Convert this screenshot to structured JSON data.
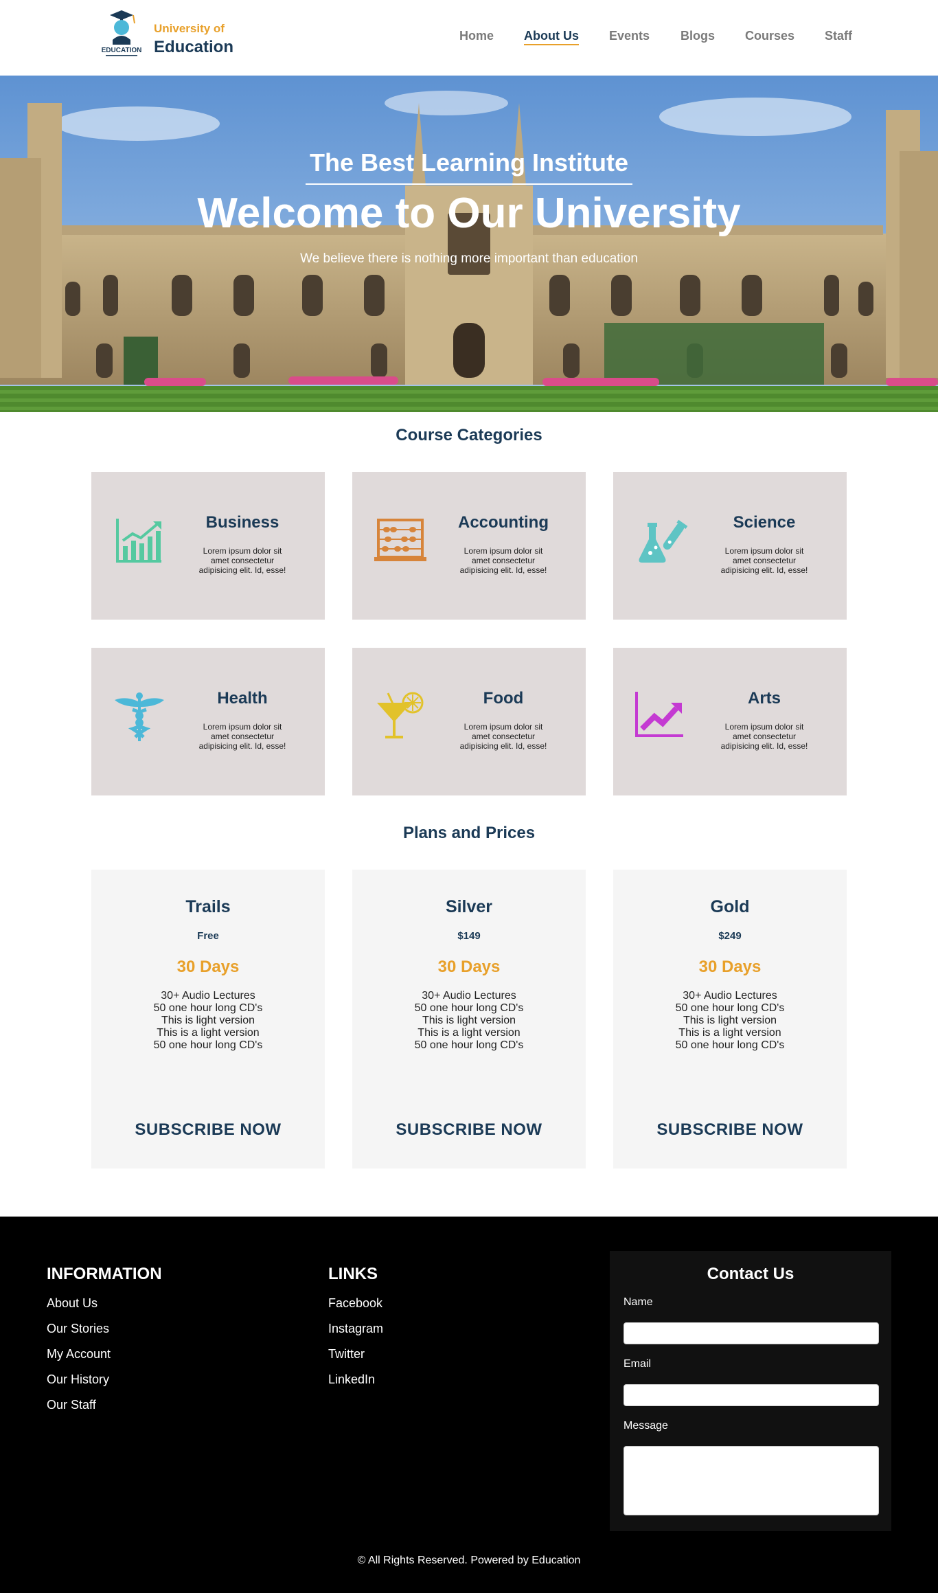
{
  "header": {
    "logo_text": "EDUCATION",
    "brand_top": "University of",
    "brand_main": "Education",
    "nav": [
      "Home",
      "About Us",
      "Events",
      "Blogs",
      "Courses",
      "Staff"
    ],
    "active_nav": "About Us"
  },
  "hero": {
    "subtitle": "The Best Learning Institute",
    "title": "Welcome to Our University",
    "tagline": "We believe there is nothing more important than education"
  },
  "categories": {
    "title": "Course Categories",
    "items": [
      {
        "name": "Business",
        "desc": "Lorem ipsum dolor sit amet consectetur adipisicing elit. Id, esse!",
        "icon": "chart-growth-icon",
        "color": "#55c9a0"
      },
      {
        "name": "Accounting",
        "desc": "Lorem ipsum dolor sit amet consectetur adipisicing elit. Id, esse!",
        "icon": "abacus-icon",
        "color": "#d7843a"
      },
      {
        "name": "Science",
        "desc": "Lorem ipsum dolor sit amet consectetur adipisicing elit. Id, esse!",
        "icon": "flask-icon",
        "color": "#5ec4c4"
      },
      {
        "name": "Health",
        "desc": "Lorem ipsum dolor sit amet consectetur adipisicing elit. Id, esse!",
        "icon": "caduceus-icon",
        "color": "#4cb8d8"
      },
      {
        "name": "Food",
        "desc": "Lorem ipsum dolor sit amet consectetur adipisicing elit. Id, esse!",
        "icon": "cocktail-icon",
        "color": "#e2c22a"
      },
      {
        "name": "Arts",
        "desc": "Lorem ipsum dolor sit amet consectetur adipisicing elit. Id, esse!",
        "icon": "trend-chart-icon",
        "color": "#c43ad2"
      }
    ]
  },
  "plans": {
    "title": "Plans and Prices",
    "items": [
      {
        "name": "Trails",
        "price": "Free",
        "days": "30 Days",
        "features": [
          "30+ Audio Lectures",
          "50 one hour long CD's",
          "This is light version",
          "This is a light version",
          "50 one hour long CD's"
        ],
        "button": "SUBSCRIBE NOW"
      },
      {
        "name": "Silver",
        "price": "$149",
        "days": "30 Days",
        "features": [
          "30+ Audio Lectures",
          "50 one hour long CD's",
          "This is light version",
          "This is a light version",
          "50 one hour long CD's"
        ],
        "button": "SUBSCRIBE NOW"
      },
      {
        "name": "Gold",
        "price": "$249",
        "days": "30 Days",
        "features": [
          "30+ Audio Lectures",
          "50 one hour long CD's",
          "This is light version",
          "This is a light version",
          "50 one hour long CD's"
        ],
        "button": "SUBSCRIBE NOW"
      }
    ]
  },
  "footer": {
    "info_title": "INFORMATION",
    "info_links": [
      "About Us",
      "Our Stories",
      "My Account",
      "Our History",
      "Our Staff"
    ],
    "links_title": "LINKS",
    "links": [
      "Facebook",
      "Instagram",
      "Twitter",
      "LinkedIn"
    ],
    "contact": {
      "title": "Contact Us",
      "name_label": "Name",
      "email_label": "Email",
      "message_label": "Message"
    },
    "copyright": "© All Rights Reserved. Powered by Education"
  },
  "colors": {
    "navy": "#1b3a56",
    "accent": "#e8a02a",
    "card_bg": "#e0dada",
    "plan_bg": "#f5f5f5",
    "footer_bg": "#000000"
  }
}
